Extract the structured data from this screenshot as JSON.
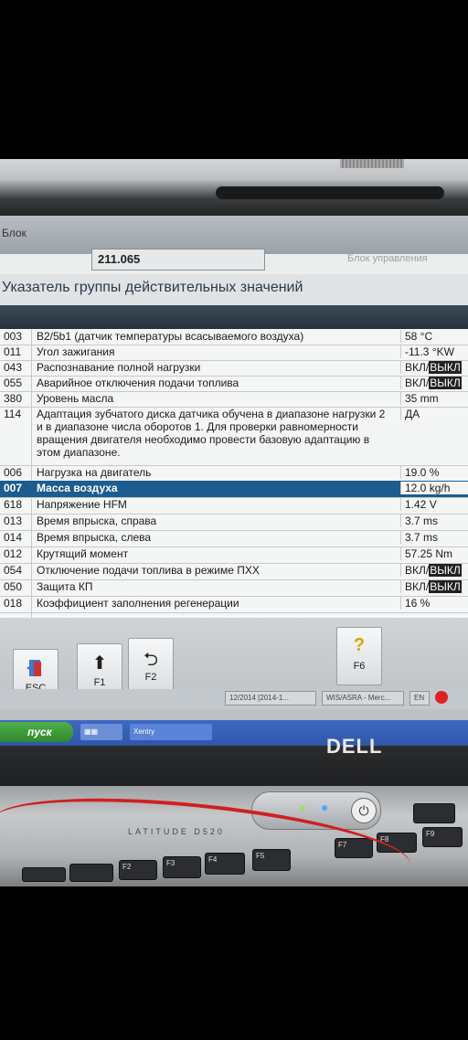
{
  "header": {
    "field_label": "Блок",
    "field_value": "211.065",
    "right_label": "Блок управления"
  },
  "group_title": "Указатель группы действительных значений",
  "rows": [
    {
      "code": "003",
      "desc": "B2/5b1 (датчик температуры всасываемого воздуха)",
      "value": "58 °C"
    },
    {
      "code": "011",
      "desc": "Угол зажигания",
      "value": "-11.3 °KW"
    },
    {
      "code": "043",
      "desc": "Распознавание полной нагрузки",
      "value": "ВКЛ/",
      "tag": "ВЫКЛ"
    },
    {
      "code": "055",
      "desc": "Аварийное отключения подачи топлива",
      "value": "ВКЛ/",
      "tag": "ВЫКЛ"
    },
    {
      "code": "380",
      "desc": "Уровень масла",
      "value": "35 mm"
    },
    {
      "code": "114",
      "desc": "Адаптация зубчатого диска датчика обучена в диапазоне нагрузки 2 и в диапазоне числа оборотов 1. Для проверки равномерности вращения двигателя необходимо провести базовую адаптацию в этом диапазоне.",
      "value": "ДА"
    },
    {
      "code": "006",
      "desc": "Нагрузка на двигатель",
      "value": "19.0 %"
    },
    {
      "code": "007",
      "desc": "Масса воздуха",
      "value": "12.0 kg/h"
    },
    {
      "code": "618",
      "desc": "Напряжение HFM",
      "value": "1.42 V"
    },
    {
      "code": "013",
      "desc": "Время впрыска, справа",
      "value": "3.7 ms"
    },
    {
      "code": "014",
      "desc": "Время впрыска, слева",
      "value": "3.7 ms"
    },
    {
      "code": "012",
      "desc": "Крутящий момент",
      "value": "57.25 Nm"
    },
    {
      "code": "054",
      "desc": "Отключение подачи топлива в режиме ПХХ",
      "value": "ВКЛ/",
      "tag": "ВЫКЛ"
    },
    {
      "code": "050",
      "desc": "Защита КП",
      "value": "ВКЛ/",
      "tag": "ВЫКЛ"
    },
    {
      "code": "018",
      "desc": "Коэффициент заполнения регенерации",
      "value": "16 %"
    }
  ],
  "buttons": {
    "esc": "ESC",
    "f1": "F1",
    "f2": "F2",
    "f6": "F6"
  },
  "status": {
    "task1": "12/2014 [2014-1...",
    "task2": "WIS/ASRA - Merc...",
    "lang": "EN"
  },
  "taskbar": {
    "start": "пуск",
    "xentry": "Xentry"
  },
  "laptop": {
    "brand": "DELL",
    "model": "LATITUDE D520",
    "keys": [
      "F2",
      "F3",
      "F4",
      "F5",
      "F7",
      "F8",
      "F9"
    ]
  }
}
